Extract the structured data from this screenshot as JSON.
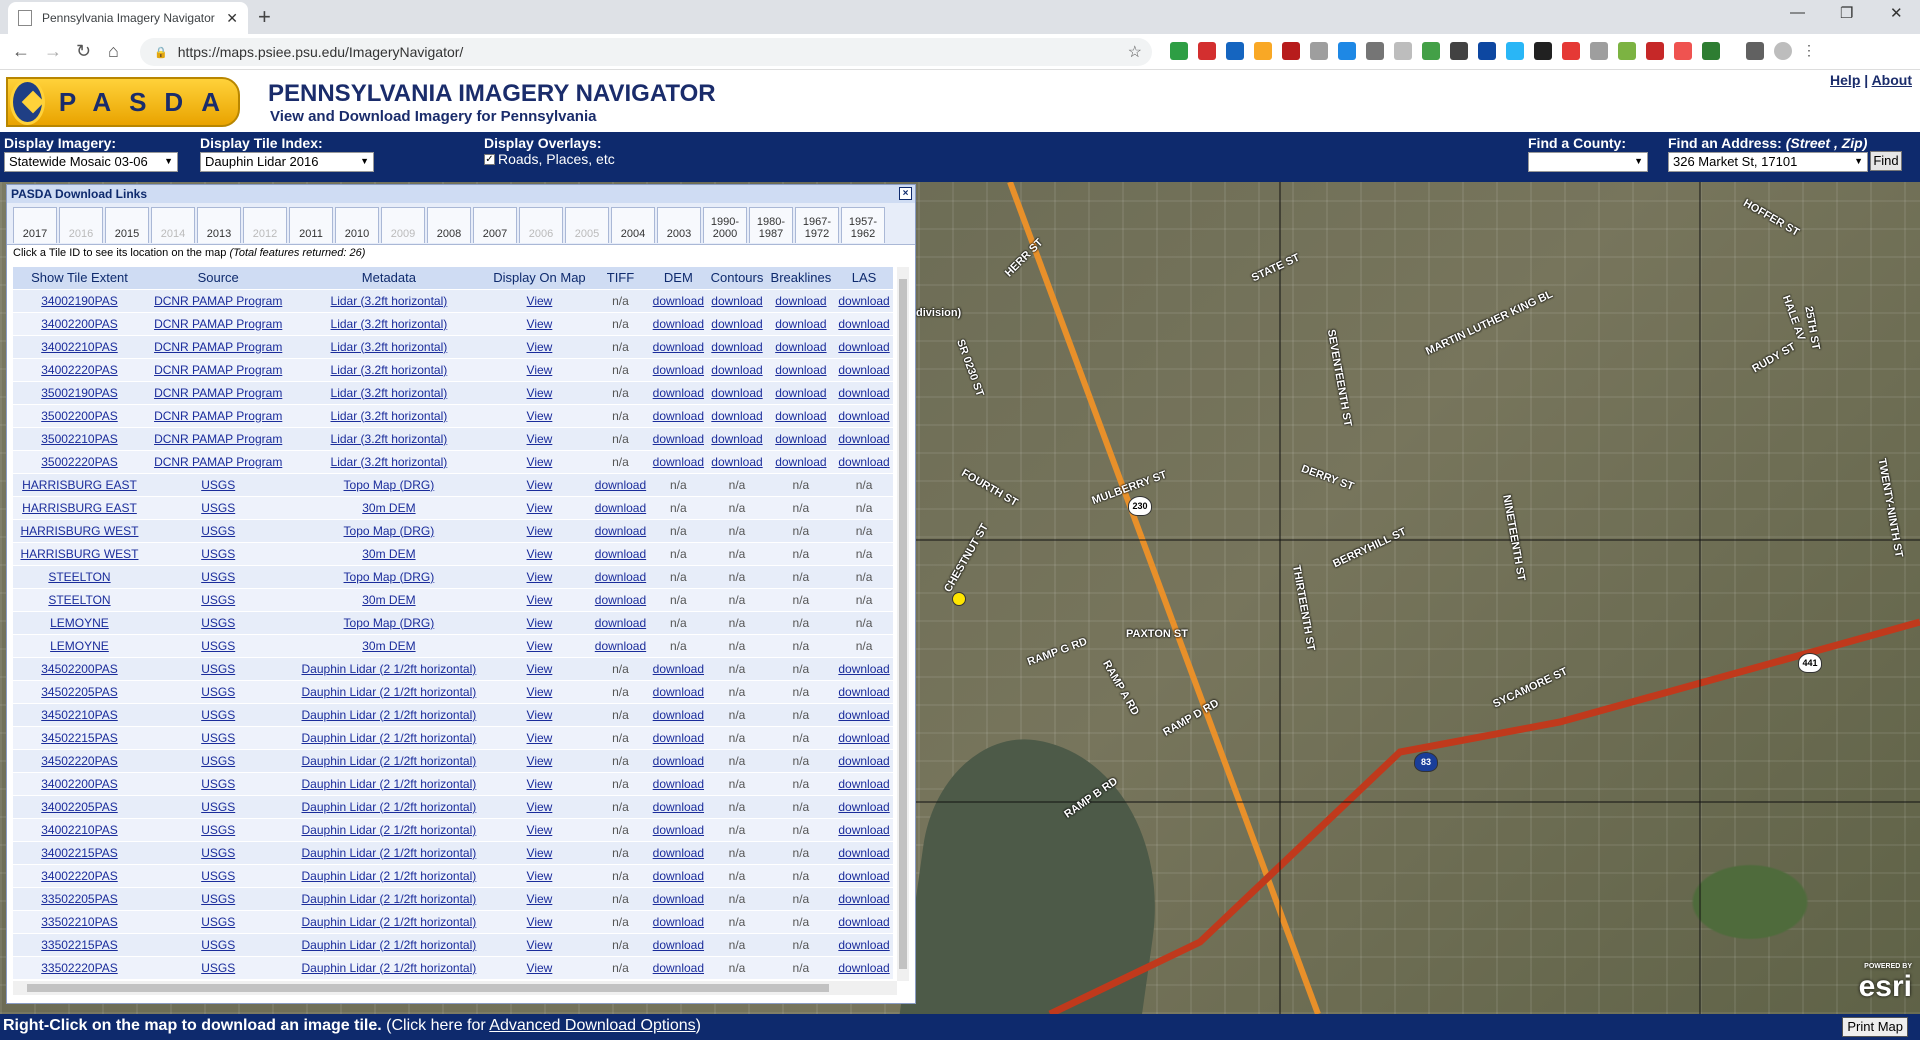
{
  "browser": {
    "tab_title": "Pennsylvania Imagery Navigator",
    "new_tab": "+",
    "url": "https://maps.psiee.psu.edu/ImageryNavigator/",
    "window_min": "—",
    "window_restore": "❐",
    "window_close": "✕"
  },
  "header": {
    "logo_text": "PASDA",
    "title": "PENNSYLVANIA IMAGERY NAVIGATOR",
    "subtitle": "View and Download Imagery for Pennsylvania",
    "help": "Help",
    "sep": "|",
    "about": "About"
  },
  "controls": {
    "display_imagery_label": "Display Imagery:",
    "display_imagery_value": "Statewide Mosaic 03-06",
    "tile_index_label": "Display Tile Index:",
    "tile_index_value": "Dauphin Lidar 2016",
    "overlays_label": "Display Overlays:",
    "overlays_option": "Roads, Places, etc",
    "find_county_label": "Find a County:",
    "find_county_value": "",
    "find_address_label": "Find an Address:",
    "find_address_hint": "(Street , Zip)",
    "find_address_value": "326 Market St, 17101",
    "find_button": "Find"
  },
  "panel": {
    "title": "PASDA Download Links",
    "close": "×",
    "years": [
      {
        "label": "2017",
        "enabled": true
      },
      {
        "label": "2016",
        "enabled": false
      },
      {
        "label": "2015",
        "enabled": true
      },
      {
        "label": "2014",
        "enabled": false
      },
      {
        "label": "2013",
        "enabled": true
      },
      {
        "label": "2012",
        "enabled": false
      },
      {
        "label": "2011",
        "enabled": true
      },
      {
        "label": "2010",
        "enabled": true
      },
      {
        "label": "2009",
        "enabled": false
      },
      {
        "label": "2008",
        "enabled": true
      },
      {
        "label": "2007",
        "enabled": true
      },
      {
        "label": "2006",
        "enabled": false
      },
      {
        "label": "2005",
        "enabled": false
      },
      {
        "label": "2004",
        "enabled": true
      },
      {
        "label": "2003",
        "enabled": true
      },
      {
        "label": "1990-2000",
        "enabled": true
      },
      {
        "label": "1980-1987",
        "enabled": true
      },
      {
        "label": "1967-1972",
        "enabled": true
      },
      {
        "label": "1957-1962",
        "enabled": true
      }
    ],
    "note_text": "Click a Tile ID to see its location on the map",
    "note_total": "(Total features returned: 26)",
    "columns": [
      "Show Tile Extent",
      "Source",
      "Metadata",
      "Display On Map",
      "TIFF",
      "DEM",
      "Contours",
      "Breaklines",
      "LAS"
    ],
    "rows": [
      [
        "34002190PAS",
        "DCNR PAMAP Program",
        "Lidar (3.2ft horizontal)",
        "View",
        "n/a",
        "download",
        "download",
        "download",
        "download"
      ],
      [
        "34002200PAS",
        "DCNR PAMAP Program",
        "Lidar (3.2ft horizontal)",
        "View",
        "n/a",
        "download",
        "download",
        "download",
        "download"
      ],
      [
        "34002210PAS",
        "DCNR PAMAP Program",
        "Lidar (3.2ft horizontal)",
        "View",
        "n/a",
        "download",
        "download",
        "download",
        "download"
      ],
      [
        "34002220PAS",
        "DCNR PAMAP Program",
        "Lidar (3.2ft horizontal)",
        "View",
        "n/a",
        "download",
        "download",
        "download",
        "download"
      ],
      [
        "35002190PAS",
        "DCNR PAMAP Program",
        "Lidar (3.2ft horizontal)",
        "View",
        "n/a",
        "download",
        "download",
        "download",
        "download"
      ],
      [
        "35002200PAS",
        "DCNR PAMAP Program",
        "Lidar (3.2ft horizontal)",
        "View",
        "n/a",
        "download",
        "download",
        "download",
        "download"
      ],
      [
        "35002210PAS",
        "DCNR PAMAP Program",
        "Lidar (3.2ft horizontal)",
        "View",
        "n/a",
        "download",
        "download",
        "download",
        "download"
      ],
      [
        "35002220PAS",
        "DCNR PAMAP Program",
        "Lidar (3.2ft horizontal)",
        "View",
        "n/a",
        "download",
        "download",
        "download",
        "download"
      ],
      [
        "HARRISBURG EAST",
        "USGS",
        "Topo Map (DRG)",
        "View",
        "download",
        "n/a",
        "n/a",
        "n/a",
        "n/a"
      ],
      [
        "HARRISBURG EAST",
        "USGS",
        "30m DEM",
        "View",
        "download",
        "n/a",
        "n/a",
        "n/a",
        "n/a"
      ],
      [
        "HARRISBURG WEST",
        "USGS",
        "Topo Map (DRG)",
        "View",
        "download",
        "n/a",
        "n/a",
        "n/a",
        "n/a"
      ],
      [
        "HARRISBURG WEST",
        "USGS",
        "30m DEM",
        "View",
        "download",
        "n/a",
        "n/a",
        "n/a",
        "n/a"
      ],
      [
        "STEELTON",
        "USGS",
        "Topo Map (DRG)",
        "View",
        "download",
        "n/a",
        "n/a",
        "n/a",
        "n/a"
      ],
      [
        "STEELTON",
        "USGS",
        "30m DEM",
        "View",
        "download",
        "n/a",
        "n/a",
        "n/a",
        "n/a"
      ],
      [
        "LEMOYNE",
        "USGS",
        "Topo Map (DRG)",
        "View",
        "download",
        "n/a",
        "n/a",
        "n/a",
        "n/a"
      ],
      [
        "LEMOYNE",
        "USGS",
        "30m DEM",
        "View",
        "download",
        "n/a",
        "n/a",
        "n/a",
        "n/a"
      ],
      [
        "34502200PAS",
        "USGS",
        "Dauphin Lidar (2 1/2ft horizontal)",
        "View",
        "n/a",
        "download",
        "n/a",
        "n/a",
        "download"
      ],
      [
        "34502205PAS",
        "USGS",
        "Dauphin Lidar (2 1/2ft horizontal)",
        "View",
        "n/a",
        "download",
        "n/a",
        "n/a",
        "download"
      ],
      [
        "34502210PAS",
        "USGS",
        "Dauphin Lidar (2 1/2ft horizontal)",
        "View",
        "n/a",
        "download",
        "n/a",
        "n/a",
        "download"
      ],
      [
        "34502215PAS",
        "USGS",
        "Dauphin Lidar (2 1/2ft horizontal)",
        "View",
        "n/a",
        "download",
        "n/a",
        "n/a",
        "download"
      ],
      [
        "34502220PAS",
        "USGS",
        "Dauphin Lidar (2 1/2ft horizontal)",
        "View",
        "n/a",
        "download",
        "n/a",
        "n/a",
        "download"
      ],
      [
        "34002200PAS",
        "USGS",
        "Dauphin Lidar (2 1/2ft horizontal)",
        "View",
        "n/a",
        "download",
        "n/a",
        "n/a",
        "download"
      ],
      [
        "34002205PAS",
        "USGS",
        "Dauphin Lidar (2 1/2ft horizontal)",
        "View",
        "n/a",
        "download",
        "n/a",
        "n/a",
        "download"
      ],
      [
        "34002210PAS",
        "USGS",
        "Dauphin Lidar (2 1/2ft horizontal)",
        "View",
        "n/a",
        "download",
        "n/a",
        "n/a",
        "download"
      ],
      [
        "34002215PAS",
        "USGS",
        "Dauphin Lidar (2 1/2ft horizontal)",
        "View",
        "n/a",
        "download",
        "n/a",
        "n/a",
        "download"
      ],
      [
        "34002220PAS",
        "USGS",
        "Dauphin Lidar (2 1/2ft horizontal)",
        "View",
        "n/a",
        "download",
        "n/a",
        "n/a",
        "download"
      ],
      [
        "33502205PAS",
        "USGS",
        "Dauphin Lidar (2 1/2ft horizontal)",
        "View",
        "n/a",
        "download",
        "n/a",
        "n/a",
        "download"
      ],
      [
        "33502210PAS",
        "USGS",
        "Dauphin Lidar (2 1/2ft horizontal)",
        "View",
        "n/a",
        "download",
        "n/a",
        "n/a",
        "download"
      ],
      [
        "33502215PAS",
        "USGS",
        "Dauphin Lidar (2 1/2ft horizontal)",
        "View",
        "n/a",
        "download",
        "n/a",
        "n/a",
        "download"
      ],
      [
        "33502220PAS",
        "USGS",
        "Dauphin Lidar (2 1/2ft horizontal)",
        "View",
        "n/a",
        "download",
        "n/a",
        "n/a",
        "download"
      ]
    ]
  },
  "map": {
    "labels": [
      "HERR ST",
      "STATE ST",
      "MARTIN LUTHER KING BL",
      "HOFFER ST",
      "HALE AV",
      "RUDY ST",
      "25TH ST",
      "TWENTY-NINTH ST",
      "SEVENTEENTH ST",
      "DERRY ST",
      "BERRYHILL ST",
      "NINETEENTH ST",
      "MULBERRY ST",
      "THIRTEENTH ST",
      "PAXTON ST",
      "RAMP G RD",
      "RAMP A RD",
      "RAMP D RD",
      "RAMP B RD",
      "SYCAMORE ST",
      "division)",
      "SR 0230 ST",
      "FOURTH ST",
      "CHESTNUT ST"
    ],
    "shields": [
      "230",
      "83",
      "441"
    ],
    "esri_small": "POWERED BY",
    "esri": "esri",
    "road_color": "#e8902a",
    "highway_color": "#c0391c"
  },
  "footer": {
    "bold_text": "Right-Click on the map to download an image tile.",
    "pre_link": "(Click here for",
    "link": "Advanced Download Options",
    "post_link": ")",
    "print_button": "Print Map"
  },
  "colors": {
    "navy": "#0e2a6d",
    "panel_header": "#cfdcf3",
    "link": "#1a2c9b",
    "logo_gold": "#ffd23a"
  }
}
